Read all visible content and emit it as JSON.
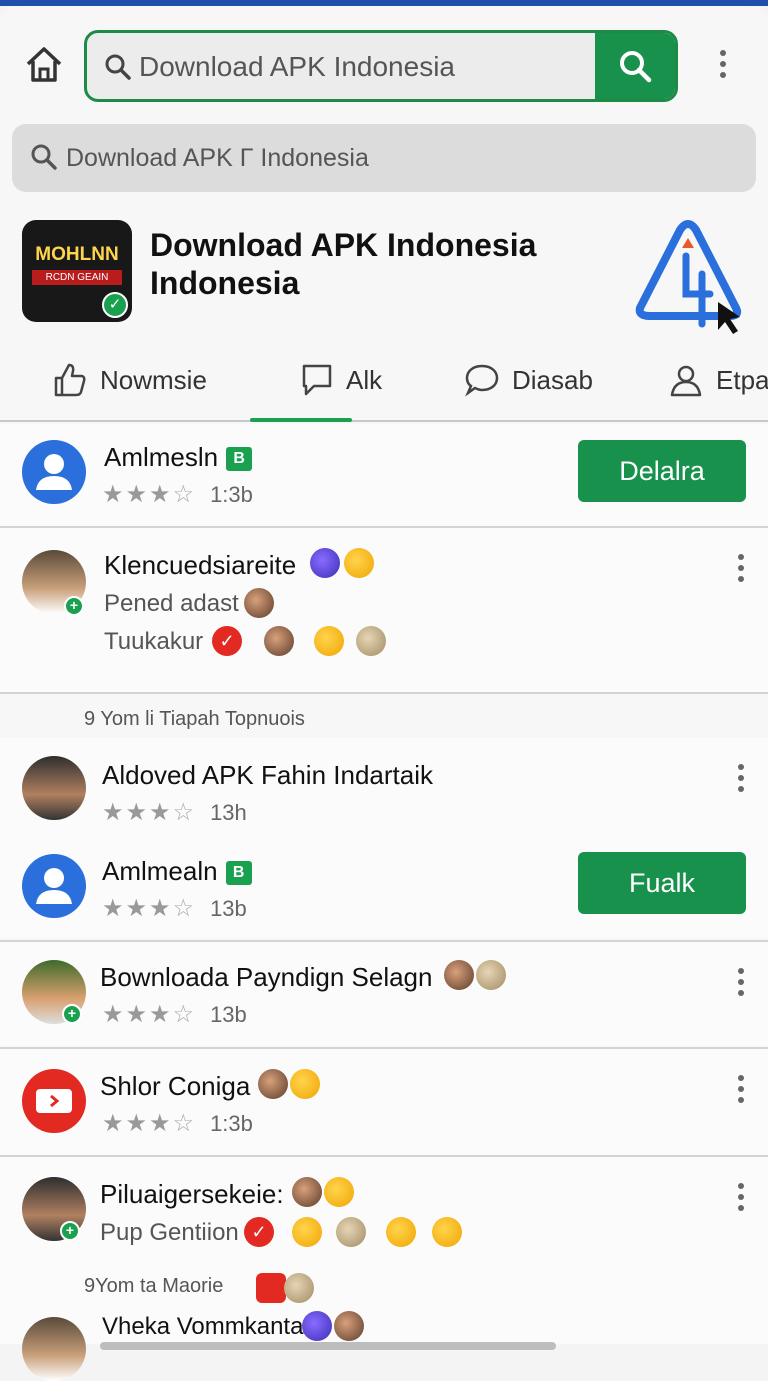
{
  "search": {
    "placeholder": "Download APK Indonesia"
  },
  "search2": {
    "placeholder": "Download APK Γ Indonesia"
  },
  "app": {
    "icon_line1": "MOHLNN",
    "icon_line2": "RCDN GEAIN",
    "title_line1": "Download APK Indonesia",
    "title_line2": "Indonesia"
  },
  "tabs": [
    "Nowmsie",
    "Alk",
    "Diasab",
    "Etpa"
  ],
  "items": [
    {
      "name": "Amlmesln",
      "badge": "B",
      "rating_stars": 3,
      "meta": "1:3b",
      "button": "Delalra"
    },
    {
      "name": "Klencuedsiareite",
      "sub": "Pened adast",
      "sub2": "Tuukakur"
    }
  ],
  "section1": "9 Yom li Tiapah Topnuois",
  "items2": [
    {
      "name": "Aldoved APK Fahin Indartaik",
      "rating_stars": 3,
      "meta": "13h"
    },
    {
      "name": "Amlmealn",
      "badge": "B",
      "rating_stars": 3,
      "meta": "13b",
      "button": "Fualk"
    },
    {
      "name": "Bownloada Payndign Selagn",
      "rating_stars": 3,
      "meta": "13b"
    },
    {
      "name": "Shlor Coniga",
      "rating_stars": 3,
      "meta": "1:3b"
    },
    {
      "name": "Piluaigersekeie:",
      "sub": "Pup Gentiion"
    }
  ],
  "section2": "9Yom ta Maorie",
  "last_item": {
    "name": "Vheka Vommkantal"
  },
  "colors": {
    "accent": "#17914b",
    "topbar": "#1f4fa8",
    "brand_blue": "#2a6fdb"
  }
}
